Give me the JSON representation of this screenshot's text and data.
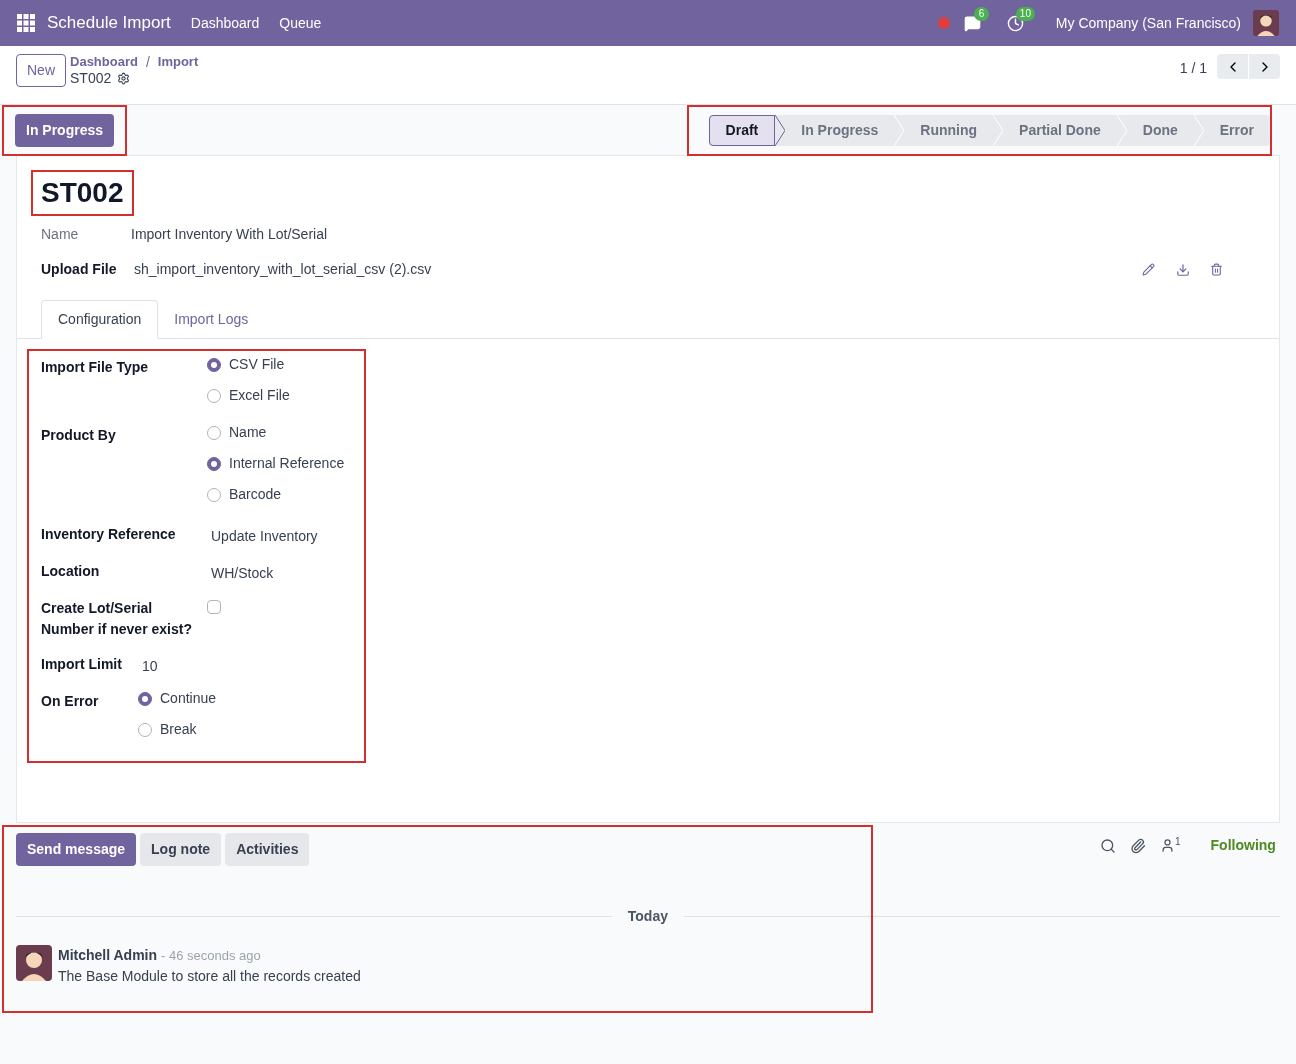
{
  "navbar": {
    "app_name": "Schedule Import",
    "menu": [
      "Dashboard",
      "Queue"
    ],
    "messages_badge": "6",
    "activities_badge": "10",
    "company": "My Company (San Francisco)"
  },
  "control_panel": {
    "new_button": "New",
    "breadcrumbs": [
      "Dashboard",
      "Import"
    ],
    "breadcrumb_separator": "/",
    "record": "ST002",
    "pager": "1 / 1"
  },
  "header": {
    "action_button": {
      "label": "In Progress",
      "highlighted": true
    },
    "statusbar": {
      "highlighted": true,
      "stages": [
        {
          "label": "Draft",
          "selected": true
        },
        {
          "label": "In Progress",
          "selected": false
        },
        {
          "label": "Running",
          "selected": false
        },
        {
          "label": "Partial Done",
          "selected": false
        },
        {
          "label": "Done",
          "selected": false
        },
        {
          "label": "Error",
          "selected": false
        }
      ]
    }
  },
  "sheet": {
    "title": {
      "text": "ST002",
      "highlighted": true
    },
    "name": {
      "label": "Name",
      "value": "Import Inventory With Lot/Serial"
    },
    "upload_file": {
      "label": "Upload File",
      "value": "sh_import_inventory_with_lot_serial_csv (2).csv"
    },
    "tabs": [
      {
        "label": "Configuration",
        "selected": true
      },
      {
        "label": "Import Logs",
        "selected": false
      }
    ],
    "configuration": {
      "highlighted": true,
      "groups": [
        {
          "fields": [
            {
              "kind": "radio",
              "label": "Import File Type",
              "options": [
                {
                  "label": "CSV File",
                  "selected": true
                },
                {
                  "label": "Excel File",
                  "selected": false
                }
              ]
            },
            {
              "kind": "radio",
              "label": "Product By",
              "options": [
                {
                  "label": "Name",
                  "selected": false
                },
                {
                  "label": "Internal Reference",
                  "selected": true
                },
                {
                  "label": "Barcode",
                  "selected": false
                }
              ]
            },
            {
              "kind": "text",
              "label": "Inventory Reference",
              "value": "Update Inventory"
            },
            {
              "kind": "text",
              "label": "Location",
              "value": "WH/Stock"
            },
            {
              "kind": "checkbox",
              "label": "Create Lot/Serial Number if never exist?",
              "checked": false
            }
          ]
        },
        {
          "fields": [
            {
              "kind": "text",
              "label": "Import Limit",
              "value": "10"
            },
            {
              "kind": "radio",
              "label": "On Error",
              "options": [
                {
                  "label": "Continue",
                  "selected": true
                },
                {
                  "label": "Break",
                  "selected": false
                }
              ]
            }
          ]
        }
      ]
    }
  },
  "chatter": {
    "highlighted": true,
    "buttons": [
      {
        "label": "Send message",
        "selected": true
      },
      {
        "label": "Log note",
        "selected": false
      },
      {
        "label": "Activities",
        "selected": false
      }
    ],
    "followers_count": "1",
    "following": "Following",
    "date_separator": "Today",
    "messages": [
      {
        "author": "Mitchell Admin",
        "time": "- 46 seconds ago",
        "body": "The Base Module to store all the records created"
      }
    ]
  }
}
